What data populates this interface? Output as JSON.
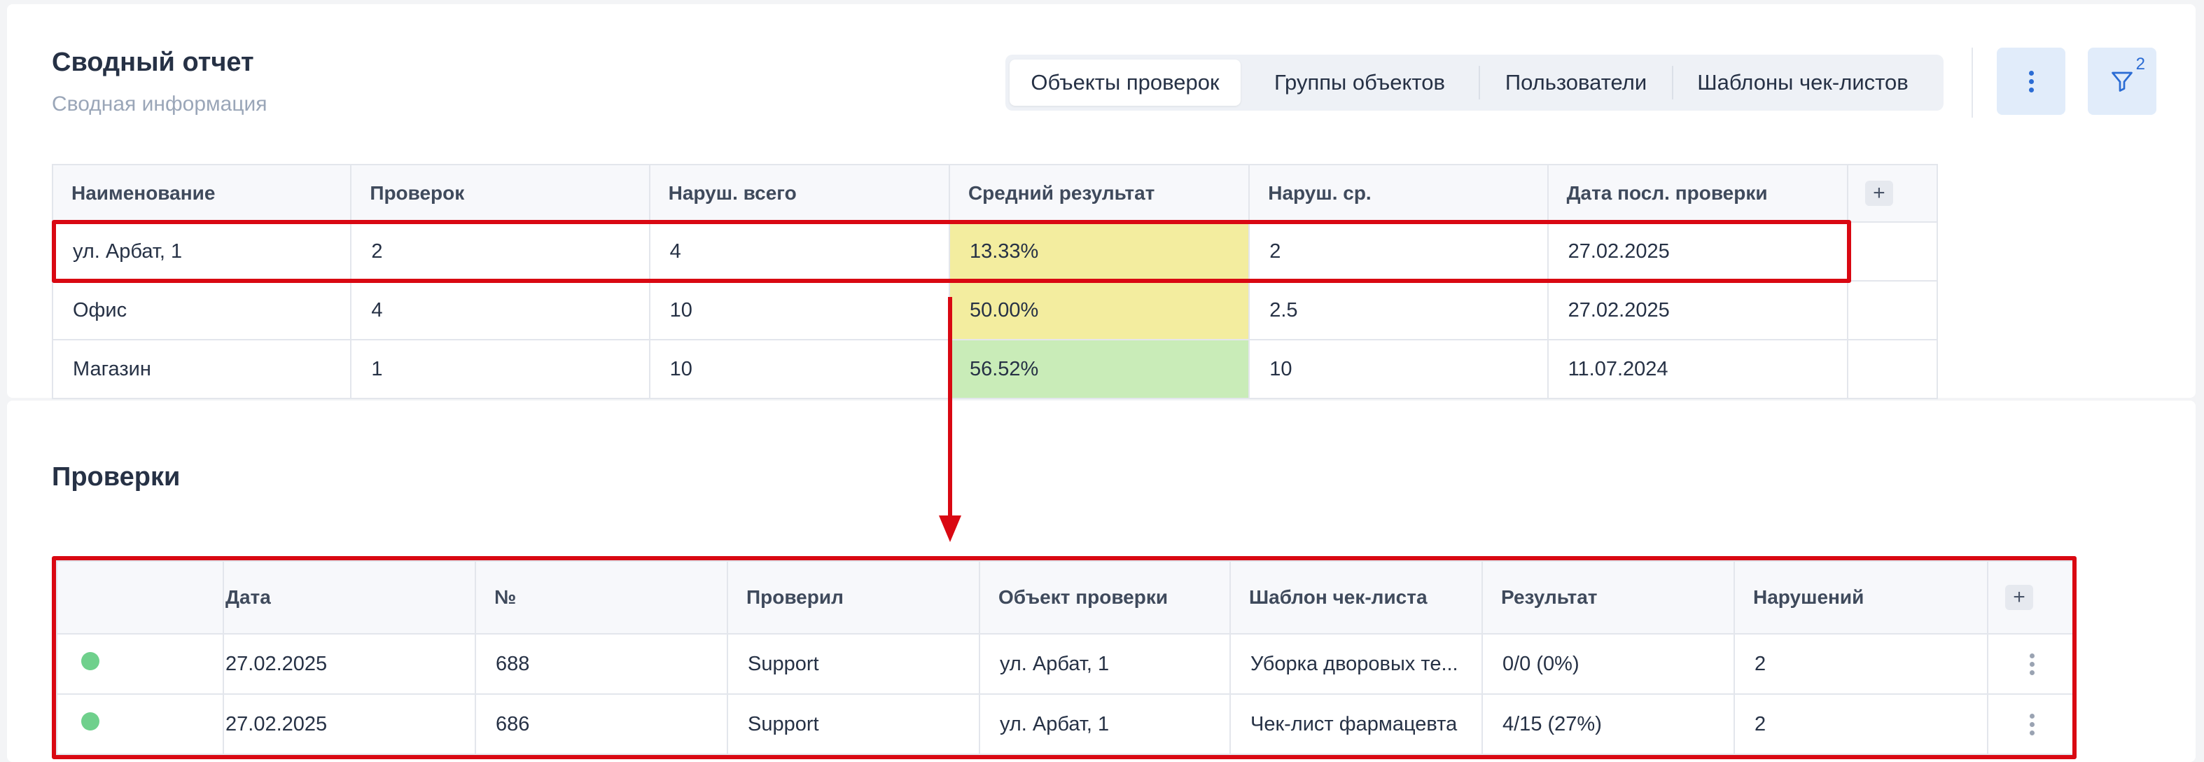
{
  "report": {
    "title": "Сводный отчет",
    "subtitle": "Сводная информация"
  },
  "tabs": [
    {
      "label": "Объекты проверок",
      "active": true
    },
    {
      "label": "Группы объектов",
      "active": false
    },
    {
      "label": "Пользователи",
      "active": false
    },
    {
      "label": "Шаблоны чек-листов",
      "active": false
    }
  ],
  "toolbar": {
    "more_icon": "vertical-dots-icon",
    "filter_icon": "filter-icon",
    "filter_count": "2"
  },
  "summary_table": {
    "headers": [
      "Наименование",
      "Проверок",
      "Наруш. всего",
      "Средний результат",
      "Наруш. ср.",
      "Дата посл. проверки"
    ],
    "add_column_label": "+",
    "rows": [
      {
        "name": "ул. Арбат, 1",
        "checks": "2",
        "violations_total": "4",
        "avg_result": "13.33%",
        "avg_result_color": "#f3ed9f",
        "violations_avg": "2",
        "last_date": "27.02.2025"
      },
      {
        "name": "Офис",
        "checks": "4",
        "violations_total": "10",
        "avg_result": "50.00%",
        "avg_result_color": "#f3ed9f",
        "violations_avg": "2.5",
        "last_date": "27.02.2025"
      },
      {
        "name": "Магазин",
        "checks": "1",
        "violations_total": "10",
        "avg_result": "56.52%",
        "avg_result_color": "#c9ecb8",
        "violations_avg": "10",
        "last_date": "11.07.2024"
      }
    ]
  },
  "checks": {
    "title": "Проверки",
    "headers": [
      "Дата",
      "№",
      "Проверил",
      "Объект проверки",
      "Шаблон чек-листа",
      "Результат",
      "Нарушений"
    ],
    "add_column_label": "+",
    "rows": [
      {
        "status_color": "#6fd08c",
        "date": "27.02.2025",
        "number": "688",
        "inspector": "Support",
        "object": "ул. Арбат, 1",
        "template": "Уборка дворовых те...",
        "result": "0/0 (0%)",
        "violations": "2"
      },
      {
        "status_color": "#6fd08c",
        "date": "27.02.2025",
        "number": "686",
        "inspector": "Support",
        "object": "ул. Арбат, 1",
        "template": "Чек-лист фармацевта",
        "result": "4/15 (27%)",
        "violations": "2"
      }
    ]
  },
  "annotation_color": "#d90812"
}
